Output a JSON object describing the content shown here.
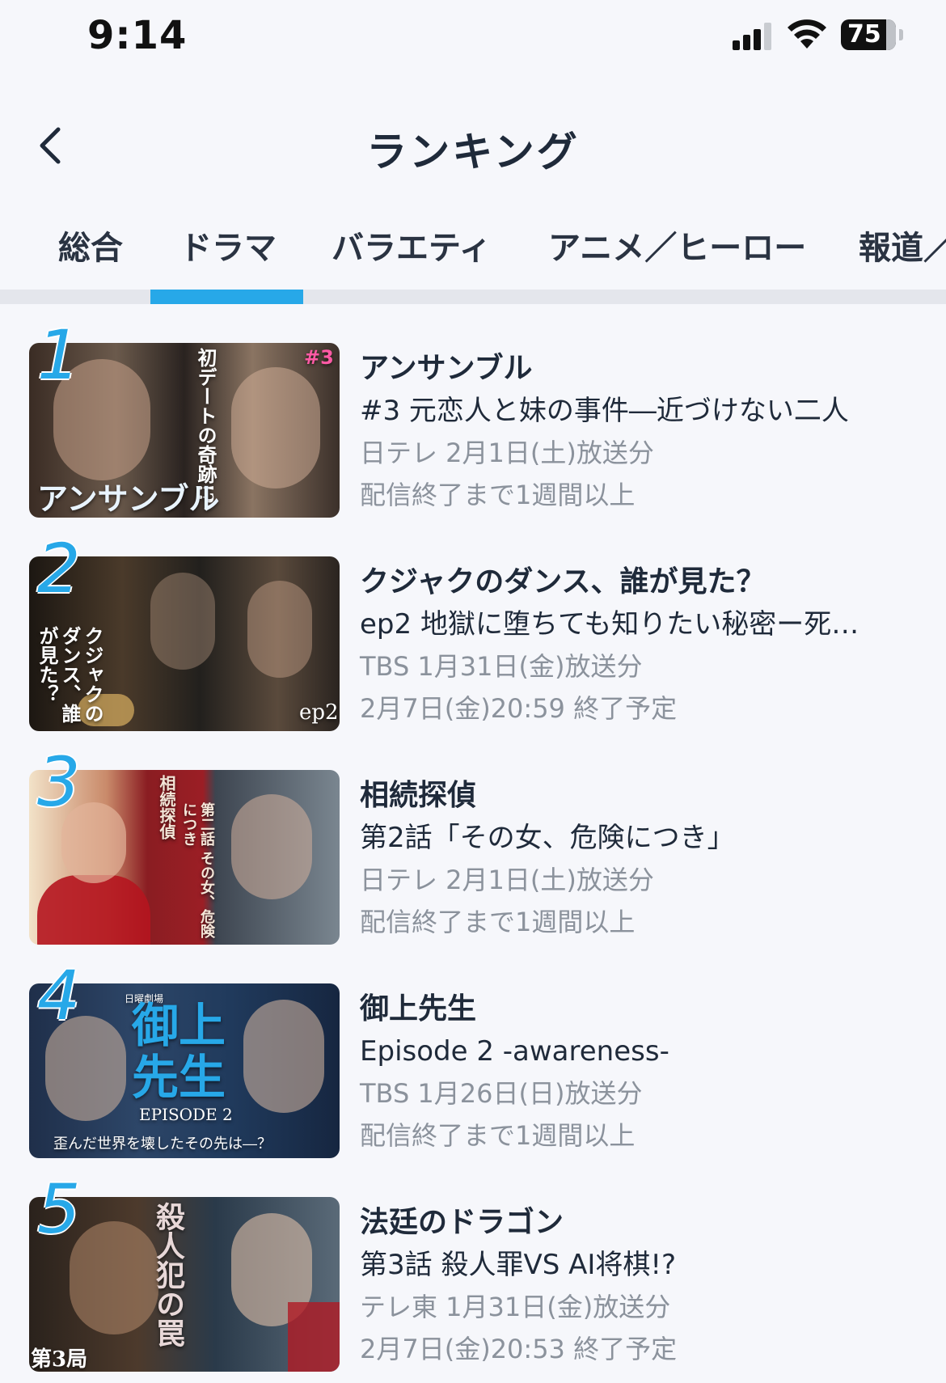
{
  "status_bar": {
    "time": "9:14",
    "battery": "75"
  },
  "header": {
    "title": "ランキング",
    "back_icon": "chevron-left-icon"
  },
  "tabs": [
    {
      "label": "総合",
      "selected": false
    },
    {
      "label": "ドラマ",
      "selected": true
    },
    {
      "label": "バラエティ",
      "selected": false
    },
    {
      "label": "アニメ／ヒーロー",
      "selected": false
    },
    {
      "label": "報道／",
      "selected": false
    }
  ],
  "colors": {
    "accent": "#27a8e8",
    "text": "#1f2a3a",
    "subtext": "#8b929c"
  },
  "ranking": [
    {
      "rank": "1",
      "title": "アンサンブル",
      "episode": "#3 元恋人と妹の事件―近づけない二人",
      "broadcast": "日テレ 2月1日(土)放送分",
      "availability": "配信終了まで1週間以上",
      "thumb_text": [
        "初デートの奇跡!?",
        "アンサンブル",
        "#3"
      ]
    },
    {
      "rank": "2",
      "title": "クジャクのダンス、誰が見た？",
      "episode": "ep2 地獄に堕ちても知りたい秘密ー死…",
      "broadcast": "TBS 1月31日(金)放送分",
      "availability": "2月7日(金)20:59 終了予定",
      "thumb_text": [
        "クジャクのダンス、誰が見た？",
        "ep2"
      ]
    },
    {
      "rank": "3",
      "title": "相続探偵",
      "episode": "第2話「その女、危険につき」",
      "broadcast": "日テレ 2月1日(土)放送分",
      "availability": "配信終了まで1週間以上",
      "thumb_text": [
        "相続探偵",
        "第二話 その女、危険につき"
      ]
    },
    {
      "rank": "4",
      "title": "御上先生",
      "episode": "Episode 2 -awareness-",
      "broadcast": "TBS 1月26日(日)放送分",
      "availability": "配信終了まで1週間以上",
      "thumb_text": [
        "日曜劇場",
        "御上先生",
        "EPISODE 2",
        "歪んだ世界を壊したその先は―？"
      ]
    },
    {
      "rank": "5",
      "title": "法廷のドラゴン",
      "episode": "第3話 殺人罪VS AI将棋!?",
      "broadcast": "テレ東 1月31日(金)放送分",
      "availability": "2月7日(金)20:53 終了予定",
      "thumb_text": [
        "殺人犯の罠",
        "第3局"
      ]
    }
  ]
}
